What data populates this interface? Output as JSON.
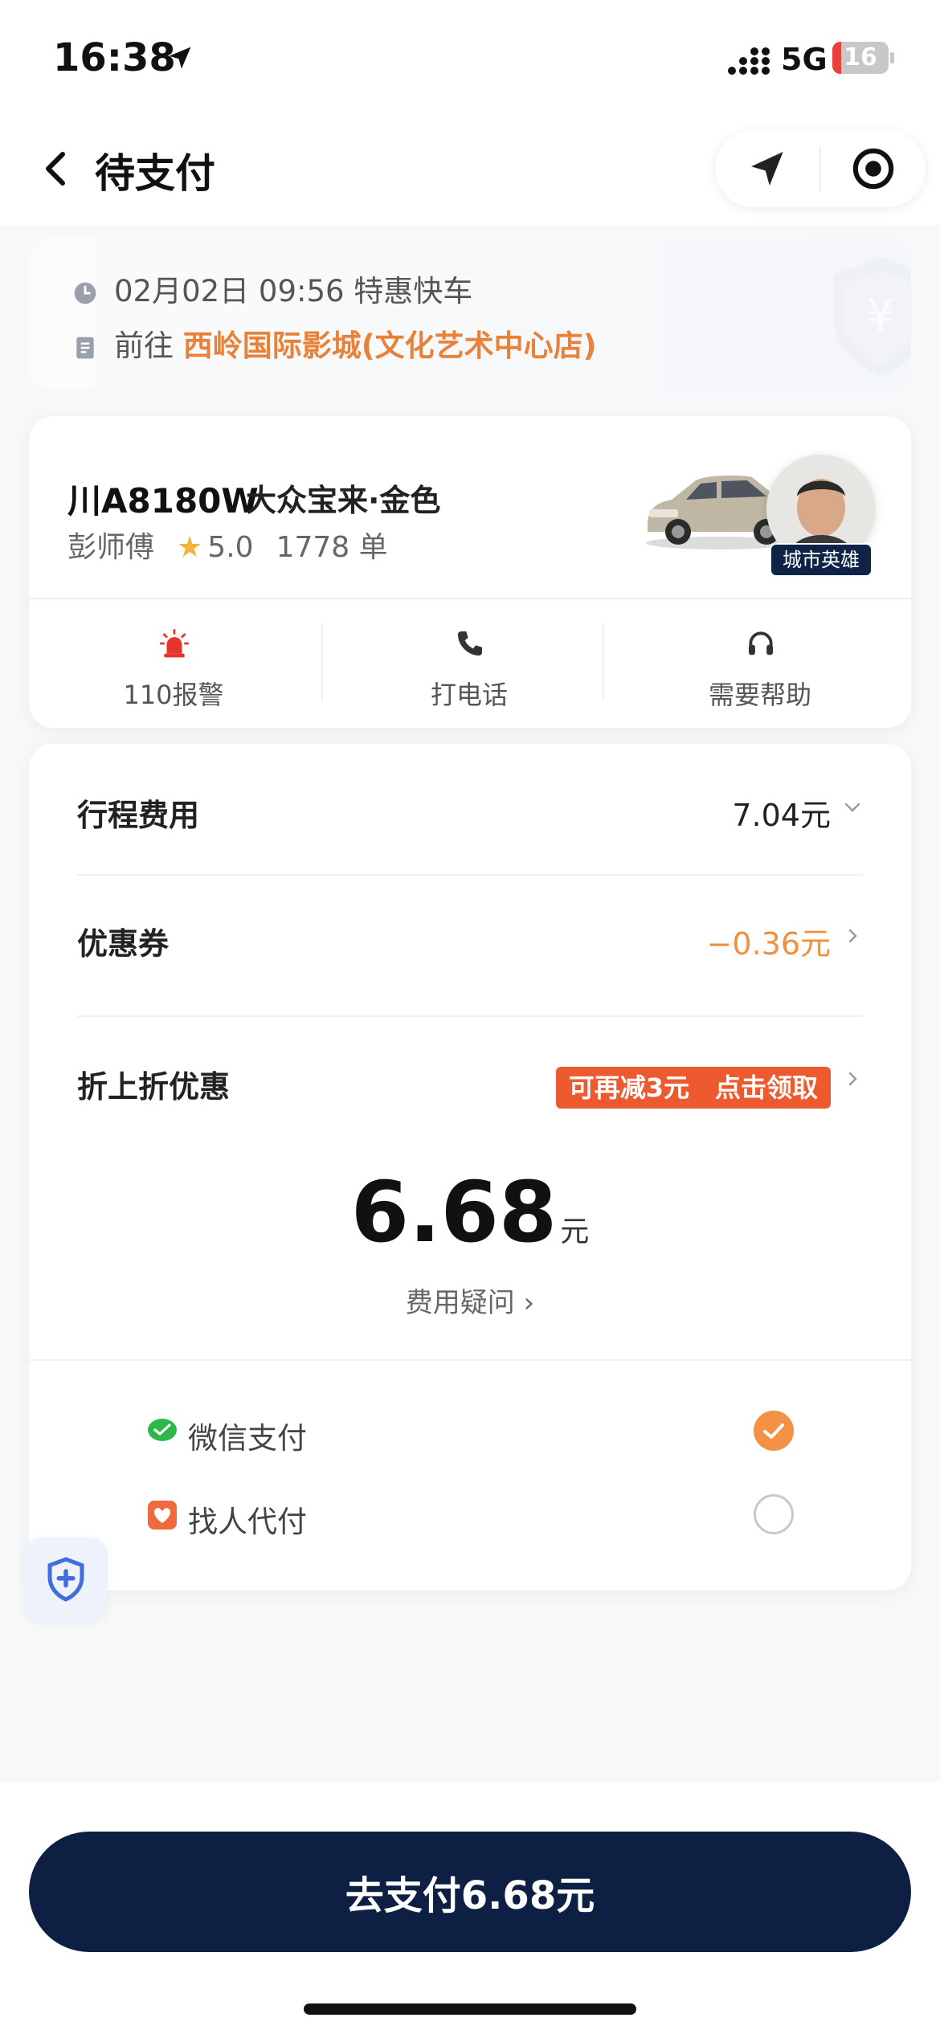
{
  "status_bar": {
    "time": "16:38",
    "network": "5G",
    "battery": "16",
    "battery_level": 0.16
  },
  "nav": {
    "title": "待支付"
  },
  "trip": {
    "datetime_type": "02月02日 09:56 特惠快车",
    "to_prefix": "前往",
    "destination": "西岭国际影城(文化艺术中心店)"
  },
  "driver": {
    "plate": "川A8180W",
    "car_model": "大众宝来·金色",
    "name": "彭师傅",
    "rating": "5.0",
    "orders": "1778 单",
    "badge": "城市英雄",
    "actions": [
      {
        "label": "110报警",
        "icon": "alarm-icon"
      },
      {
        "label": "打电话",
        "icon": "phone-icon"
      },
      {
        "label": "需要帮助",
        "icon": "headset-icon"
      }
    ]
  },
  "payment": {
    "trip_fee_label": "行程费用",
    "trip_fee_value": "7.04元",
    "coupon_label": "优惠券",
    "coupon_value": "−0.36元",
    "discount_label": "折上折优惠",
    "discount_tag": "可再减3元　点击领取",
    "total": "6.68",
    "total_unit": "元",
    "fee_question": "费用疑问 ›",
    "methods": [
      {
        "label": "微信支付",
        "icon": "wechat-pay-icon",
        "selected": true
      },
      {
        "label": "找人代付",
        "icon": "pay-for-me-icon",
        "selected": false
      }
    ]
  },
  "pay_button": "去支付6.68元",
  "colors": {
    "accent_orange": "#e8823a",
    "promo_red": "#ee5a2f",
    "button_navy": "#0e1f44",
    "check_orange": "#f39145"
  }
}
